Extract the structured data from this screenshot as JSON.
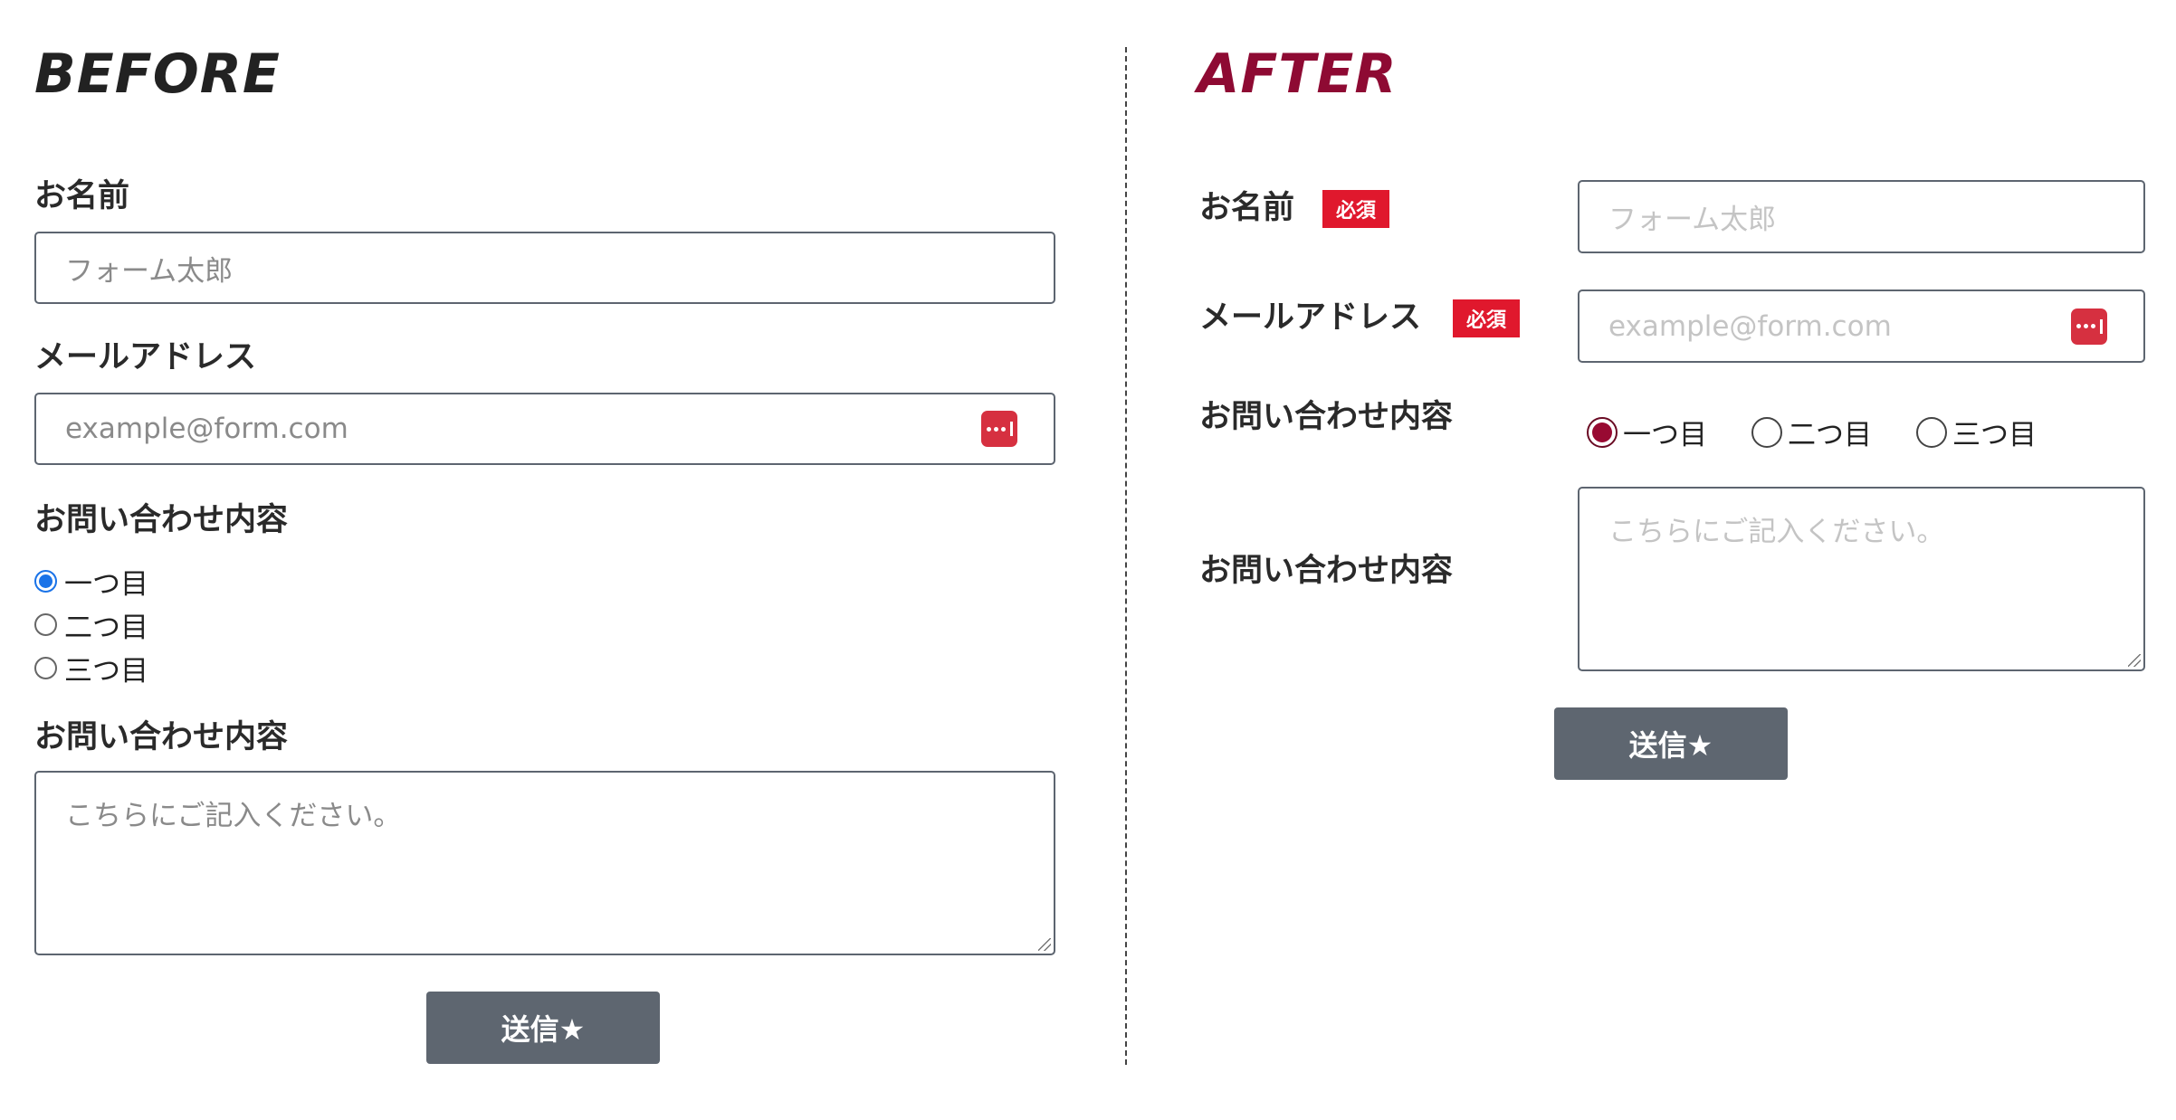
{
  "before": {
    "heading": "BEFORE",
    "name_label": "お名前",
    "name_placeholder": "フォーム太郎",
    "email_label": "メールアドレス",
    "email_placeholder": "example@form.com",
    "inquiry_label": "お問い合わせ内容",
    "radio_options": [
      "一つ目",
      "二つ目",
      "三つ目"
    ],
    "selected_option": "一つ目",
    "message_label": "お問い合わせ内容",
    "message_placeholder": "こちらにご記入ください。",
    "submit_label": "送信★"
  },
  "after": {
    "heading": "AFTER",
    "name_label": "お名前",
    "required_badge": "必須",
    "name_placeholder": "フォーム太郎",
    "email_label": "メールアドレス",
    "email_placeholder": "example@form.com",
    "inquiry_label": "お問い合わせ内容",
    "radio_options": [
      "一つ目",
      "二つ目",
      "三つ目"
    ],
    "selected_option": "一つ目",
    "message_label": "お問い合わせ内容",
    "message_placeholder": "こちらにご記入ください。",
    "submit_label": "送信★"
  },
  "colors": {
    "before_heading": "#222222",
    "after_heading": "#8e0a33",
    "required_badge": "#e0182d",
    "button": "#5e6670",
    "password_icon": "#d63040",
    "radio_before_selected": "#1a73e8",
    "radio_after_selected": "#980a32"
  },
  "icons": {
    "password_manager": "password-manager-icon",
    "resize_handle": "resize-handle-icon"
  }
}
